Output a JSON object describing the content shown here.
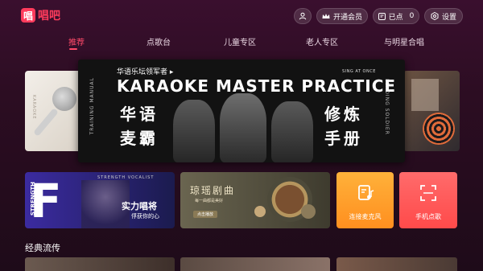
{
  "app": {
    "logo_mark": "唱",
    "logo_text": "唱吧"
  },
  "topbar": {
    "user_icon": "user-icon",
    "vip_label": "开通会员",
    "vip_icon": "crown-icon",
    "queue_label": "已点",
    "queue_count": "0",
    "queue_icon": "playlist-icon",
    "settings_label": "设置",
    "settings_icon": "gear-icon"
  },
  "nav": {
    "items": [
      "推荐",
      "点歌台",
      "儿童专区",
      "老人专区",
      "与明星合唱"
    ],
    "active_index": 0,
    "active_color": "#ff4a6a"
  },
  "banner": {
    "top_line": "华语乐坛领军者 ▸",
    "sing_at_once": "SING AT ONCE",
    "title": "KARAOKE MASTER PRACTICE",
    "left_vertical": "TRAINING MANUAL",
    "right_vertical": "LEADING SOLDIER",
    "line1_left": "华语",
    "line2_left": "麦霸",
    "line1_right": "修炼",
    "line2_right": "手册"
  },
  "card_left": {
    "vertical_text": "KARAOKE"
  },
  "row2": {
    "strength": {
      "big_letter": "F",
      "vertical": "STRENGTH",
      "header": "STRENGTH VOCALIST",
      "title": "实力唱将",
      "subtitle": "俘获你的心"
    },
    "qiong": {
      "title": "琼瑶剧曲",
      "subtitle": "每一曲都是美好",
      "tag": "点击播放"
    },
    "mic": {
      "label": "连接麦克风",
      "icon": "music-note-icon",
      "color": "#ff9a2a"
    },
    "phone": {
      "label": "手机点歌",
      "icon": "scan-icon",
      "color": "#ff5454"
    }
  },
  "section": {
    "title": "经典流传"
  }
}
